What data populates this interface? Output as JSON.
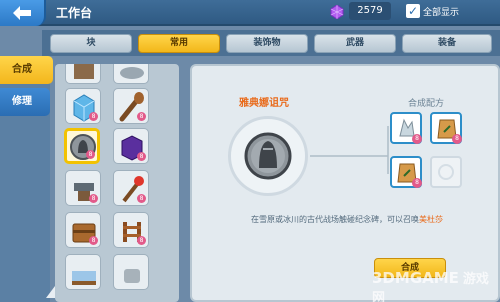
{
  "header": {
    "title": "工作台",
    "gem_count": "2579",
    "show_all_label": "全部显示",
    "show_all_checked": true
  },
  "tabs": [
    {
      "label": "块",
      "active": false
    },
    {
      "label": "常用",
      "active": true
    },
    {
      "label": "装饰物",
      "active": false
    },
    {
      "label": "武器",
      "active": false
    },
    {
      "label": "装备",
      "active": false
    }
  ],
  "side_tabs": [
    {
      "label": "合成",
      "active": true
    },
    {
      "label": "修理",
      "active": false
    }
  ],
  "grid_slots": [
    {
      "icon": "block-item-icon",
      "badge": ""
    },
    {
      "icon": "disc-item-icon",
      "badge": ""
    },
    {
      "icon": "ice-block-icon",
      "badge": "8"
    },
    {
      "icon": "club-icon",
      "badge": "8"
    },
    {
      "icon": "athena-medal-icon",
      "badge": "8",
      "selected": true
    },
    {
      "icon": "purple-block-icon",
      "badge": "8"
    },
    {
      "icon": "anvil-icon",
      "badge": "8"
    },
    {
      "icon": "torch-icon",
      "badge": "8"
    },
    {
      "icon": "chest-icon",
      "badge": "8"
    },
    {
      "icon": "wooden-fence-icon",
      "badge": "8"
    },
    {
      "icon": "bed-icon",
      "badge": ""
    },
    {
      "icon": "pot-icon",
      "badge": ""
    }
  ],
  "detail": {
    "item_name": "雅典娜诅咒",
    "recipe_title": "合成配方",
    "description_prefix": "在雪原或冰川的古代战场触碰纪念碑，可以召唤",
    "description_highlight": "美杜莎",
    "craft_label": "合成"
  },
  "recipe": [
    {
      "icon": "crystal-shard-icon",
      "badge": "8"
    },
    {
      "icon": "seed-bag-icon",
      "badge": "8"
    },
    {
      "icon": "seed-bag-icon",
      "badge": "8"
    },
    {
      "icon": "empty-slot-icon",
      "badge": ""
    }
  ],
  "watermark": {
    "brand": "3DMGAME",
    "site": "游戏网"
  },
  "colors": {
    "accent": "#f2b71a",
    "header": "#2f5a83",
    "highlight": "#e96a1a"
  }
}
